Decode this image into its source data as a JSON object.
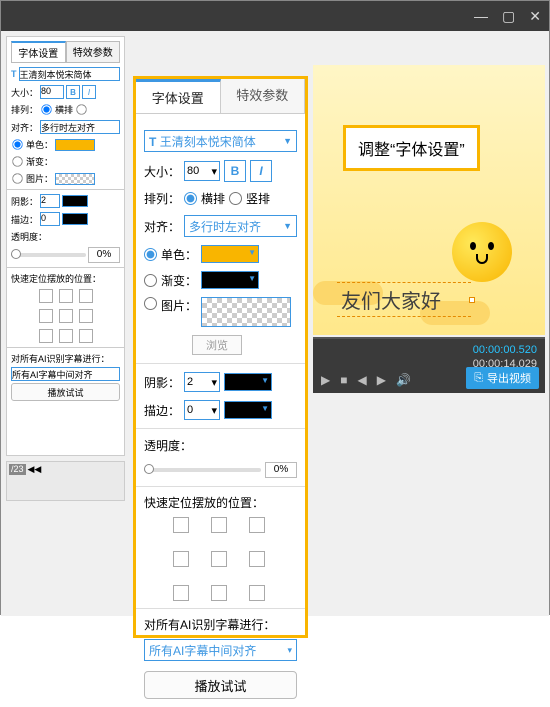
{
  "labels": {
    "size": "大小：",
    "layout": "排列：",
    "align": "对齐：",
    "horiz": "横排",
    "vert": "竖排",
    "solid": "单色：",
    "gradient": "渐变：",
    "image": "图片：",
    "browse": "浏览",
    "shadow": "阴影：",
    "stroke": "描边：",
    "opacity": "透明度：",
    "quickPos": "快速定位摆放的位置：",
    "allAI": "对所有AI识别字幕进行：",
    "playTest": "播放试试"
  },
  "smallPanel": {
    "tab1": "字体设置",
    "tab2": "特效参数",
    "font": "王清刻本悦宋简体",
    "size": "80",
    "align": "多行时左对齐",
    "shadow": "2",
    "stroke": "0",
    "opacity": "0%",
    "aiAlign": "所有AI字幕中间对齐"
  },
  "bigPanel": {
    "tab1": "字体设置",
    "tab2": "特效参数",
    "font": "王清刻本悦宋简体",
    "size": "80",
    "align": "多行时左对齐",
    "shadow": "2",
    "stroke": "0",
    "opacity": "0%",
    "aiAlign": "所有AI字幕中间对齐"
  },
  "preview": {
    "callout": "调整“字体设置”",
    "subtitle": "友们大家好"
  },
  "timeline": {
    "current": "00:00:00.520",
    "total": "00:00:14.029",
    "export": "导出视频"
  },
  "colors": {
    "accent": "#f9b500",
    "blue": "#3d97e2"
  }
}
